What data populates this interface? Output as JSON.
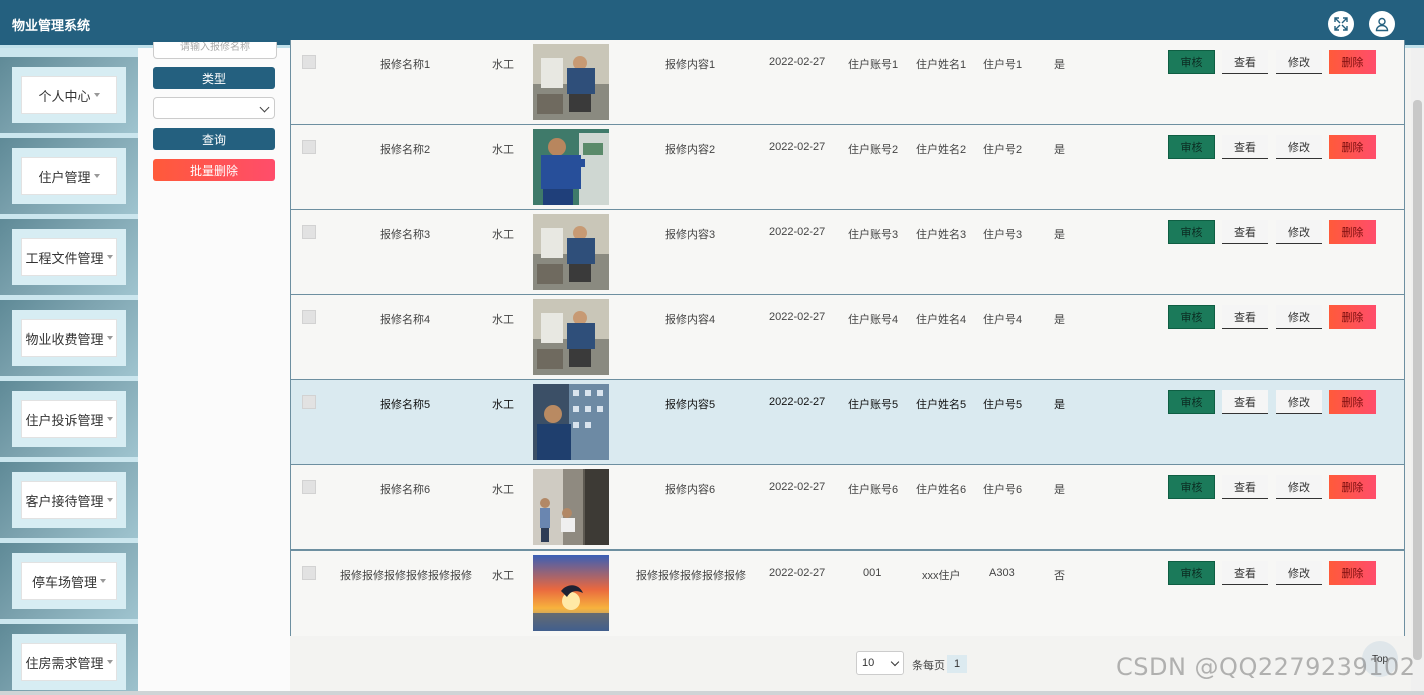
{
  "header": {
    "title": "物业管理系统"
  },
  "sidebar": {
    "items": [
      {
        "label": "个人中心"
      },
      {
        "label": "住户管理"
      },
      {
        "label": "工程文件管理"
      },
      {
        "label": "物业收费管理"
      },
      {
        "label": "住户投诉管理"
      },
      {
        "label": "客户接待管理"
      },
      {
        "label": "停车场管理"
      },
      {
        "label": "住房需求管理"
      }
    ]
  },
  "filters": {
    "name_placeholder": "请输入报修名称",
    "type_button": "类型",
    "type_select_value": "",
    "search_button": "查询",
    "batch_delete_button": "批量删除"
  },
  "actions": {
    "audit": "审核",
    "view": "查看",
    "edit": "修改",
    "delete": "删除"
  },
  "rows": [
    {
      "name": "报修名称1",
      "type": "水工",
      "content": "报修内容1",
      "date": "2022-02-27",
      "account": "住户账号1",
      "resident_name": "住户姓名1",
      "unit": "住户号1",
      "status": "是",
      "image": "worker-photo"
    },
    {
      "name": "报修名称2",
      "type": "水工",
      "content": "报修内容2",
      "date": "2022-02-27",
      "account": "住户账号2",
      "resident_name": "住户姓名2",
      "unit": "住户号2",
      "status": "是",
      "image": "worker-photo"
    },
    {
      "name": "报修名称3",
      "type": "水工",
      "content": "报修内容3",
      "date": "2022-02-27",
      "account": "住户账号3",
      "resident_name": "住户姓名3",
      "unit": "住户号3",
      "status": "是",
      "image": "worker-photo"
    },
    {
      "name": "报修名称4",
      "type": "水工",
      "content": "报修内容4",
      "date": "2022-02-27",
      "account": "住户账号4",
      "resident_name": "住户姓名4",
      "unit": "住户号4",
      "status": "是",
      "image": "worker-photo"
    },
    {
      "name": "报修名称5",
      "type": "水工",
      "content": "报修内容5",
      "date": "2022-02-27",
      "account": "住户账号5",
      "resident_name": "住户姓名5",
      "unit": "住户号5",
      "status": "是",
      "image": "worker-photo"
    },
    {
      "name": "报修名称6",
      "type": "水工",
      "content": "报修内容6",
      "date": "2022-02-27",
      "account": "住户账号6",
      "resident_name": "住户姓名6",
      "unit": "住户号6",
      "status": "是",
      "image": "worker-photo"
    },
    {
      "name": "报修报修报修报修报修报修",
      "type": "水工",
      "content": "报修报修报修报修报修",
      "date": "2022-02-27",
      "account": "001",
      "resident_name": "xxx住户",
      "unit": "A303",
      "status": "否",
      "image": "sunset-photo"
    }
  ],
  "pagination": {
    "page_size": "10",
    "per_page_label": "条每页",
    "current_page": "1"
  },
  "top_button": "Top",
  "watermark": "CSDN @QQ2279239102",
  "colors": {
    "header": "#24607f",
    "audit": "#1b7a5a",
    "delete": "#ff5a3a",
    "highlight_row": "#daeaf0"
  }
}
